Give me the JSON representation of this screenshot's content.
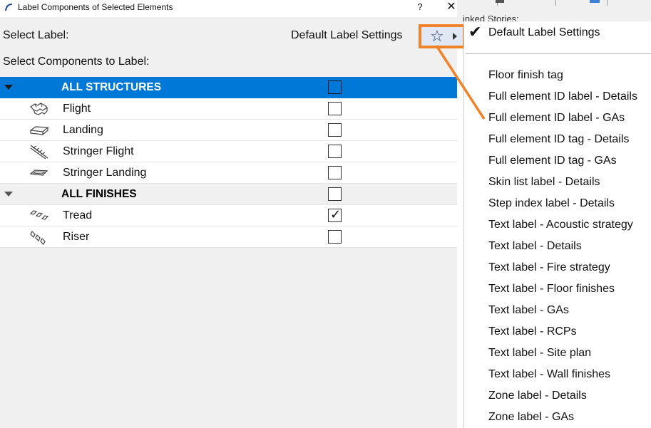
{
  "background": {
    "stories_label": "inked Stories:",
    "accent": "#3d7fd6"
  },
  "dialog": {
    "title": "Label Components of Selected Elements",
    "help_glyph": "?",
    "close_glyph": "✕",
    "select_label_text": "Select Label:",
    "current_label": "Default Label Settings",
    "components_label_text": "Select Components to Label:",
    "favorites_icon": "star-icon",
    "selection_color": "#0078d7",
    "highlight_color": "#f08229"
  },
  "groups": [
    {
      "title": "ALL STRUCTURES",
      "selected": true,
      "checked": false,
      "items": [
        {
          "label": "Flight",
          "icon": "flight-icon",
          "checked": false
        },
        {
          "label": "Landing",
          "icon": "landing-icon",
          "checked": false
        },
        {
          "label": "Stringer Flight",
          "icon": "stringer-flight-icon",
          "checked": false
        },
        {
          "label": "Stringer Landing",
          "icon": "stringer-landing-icon",
          "checked": false
        }
      ]
    },
    {
      "title": "ALL FINISHES",
      "selected": false,
      "checked": false,
      "items": [
        {
          "label": "Tread",
          "icon": "tread-icon",
          "checked": true
        },
        {
          "label": "Riser",
          "icon": "riser-icon",
          "checked": false
        }
      ]
    }
  ],
  "menu": {
    "checked_item": "Default Label Settings",
    "items": [
      "Floor finish tag",
      "Full element ID label - Details",
      "Full element ID label - GAs",
      "Full element ID tag - Details",
      "Full element ID tag - GAs",
      "Skin list label - Details",
      "Step index label - Details",
      "Text label - Acoustic strategy",
      "Text label - Details",
      "Text label - Fire strategy",
      "Text label - Floor finishes",
      "Text label - GAs",
      "Text label - RCPs",
      "Text label - Site plan",
      "Text label - Wall finishes",
      "Zone label - Details",
      "Zone label - GAs"
    ]
  }
}
